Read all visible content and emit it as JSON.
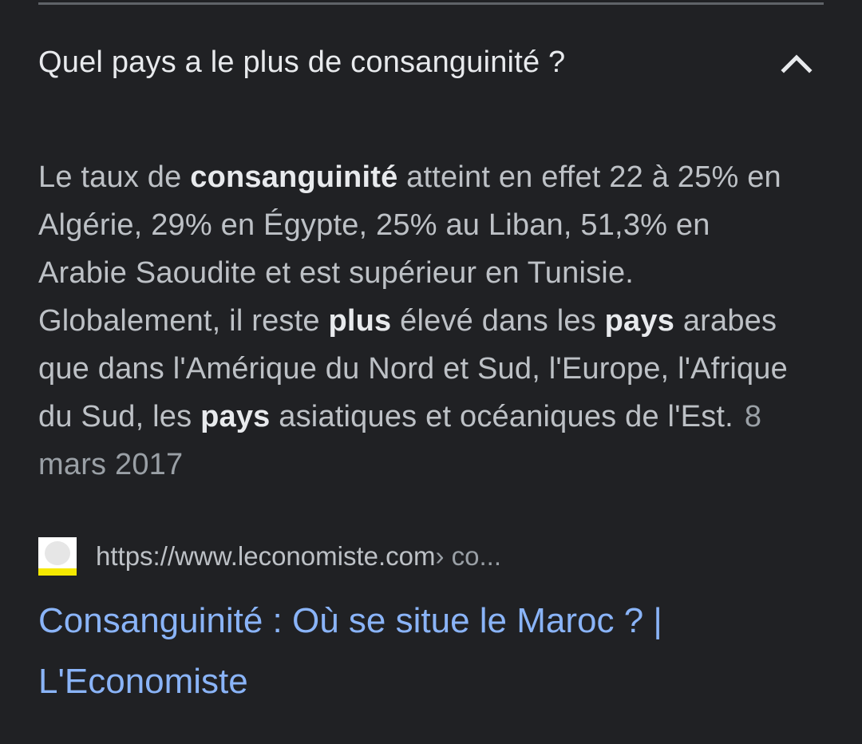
{
  "question": {
    "text": "Quel pays a le plus de consanguinité ?",
    "expand_icon": "chevron-up-icon"
  },
  "answer": {
    "segments": [
      {
        "text": "Le taux de ",
        "bold": false
      },
      {
        "text": "consanguinité",
        "bold": true
      },
      {
        "text": " atteint en effet 22 à 25% en Algérie, 29% en Égypte, 25% au Liban, 51,3% en Arabie Saoudite et est supérieur en Tunisie. Globalement, il reste ",
        "bold": false
      },
      {
        "text": "plus",
        "bold": true
      },
      {
        "text": " élevé dans les ",
        "bold": false
      },
      {
        "text": "pays",
        "bold": true
      },
      {
        "text": " arabes que dans l'Amérique du Nord et Sud, l'Europe, l'Afrique du Sud, les ",
        "bold": false
      },
      {
        "text": "pays",
        "bold": true
      },
      {
        "text": " asiatiques et océaniques de l'Est.",
        "bold": false
      }
    ],
    "date": "8 mars 2017"
  },
  "source": {
    "url": "https://www.leconomiste.com",
    "crumb": " › co..."
  },
  "result": {
    "title": "Consanguinité : Où se situe le Maroc ? | L'Economiste"
  },
  "colors": {
    "background": "#202124",
    "link": "#8ab4f8",
    "text": "#bdc1c6",
    "favicon_accent": "#f5e800"
  }
}
